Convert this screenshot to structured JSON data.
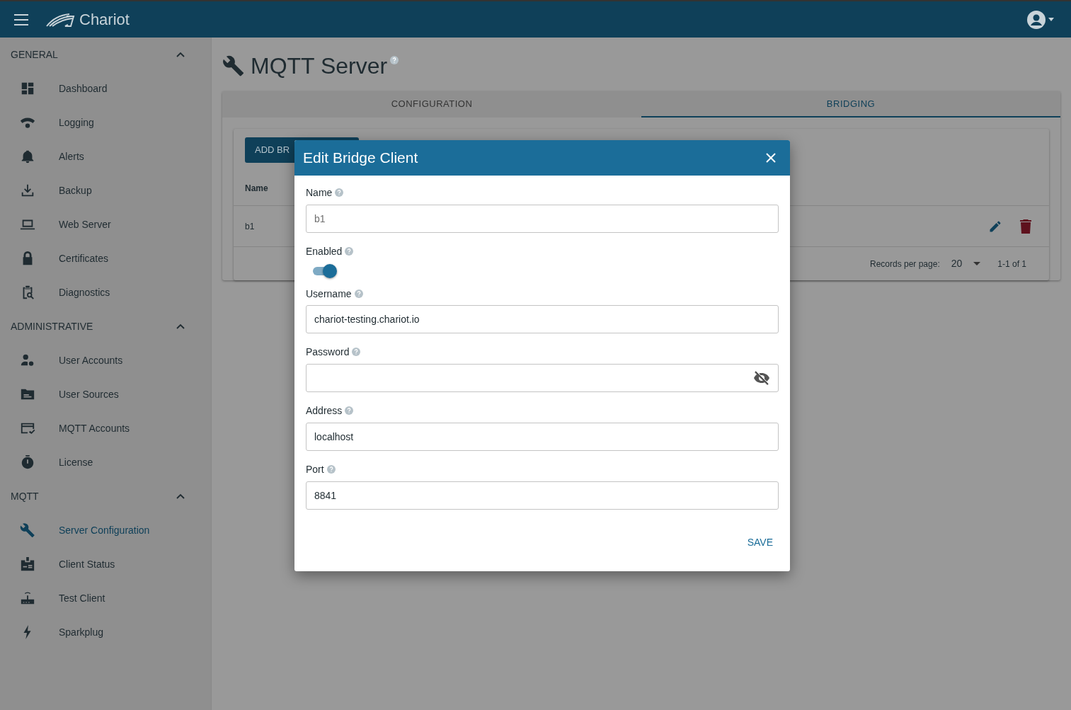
{
  "topbar": {
    "brand": "Chariot"
  },
  "sidebar": {
    "sections": [
      {
        "title": "GENERAL",
        "expanded": true,
        "items": [
          {
            "label": "Dashboard",
            "selected": false
          },
          {
            "label": "Logging",
            "selected": false
          },
          {
            "label": "Alerts",
            "selected": false
          },
          {
            "label": "Backup",
            "selected": false
          },
          {
            "label": "Web Server",
            "selected": false
          },
          {
            "label": "Certificates",
            "selected": false
          },
          {
            "label": "Diagnostics",
            "selected": false
          }
        ]
      },
      {
        "title": "ADMINISTRATIVE",
        "expanded": true,
        "items": [
          {
            "label": "User Accounts",
            "selected": false
          },
          {
            "label": "User Sources",
            "selected": false
          },
          {
            "label": "MQTT Accounts",
            "selected": false
          },
          {
            "label": "License",
            "selected": false
          }
        ]
      },
      {
        "title": "MQTT",
        "expanded": true,
        "items": [
          {
            "label": "Server Configuration",
            "selected": true
          },
          {
            "label": "Client Status",
            "selected": false
          },
          {
            "label": "Test Client",
            "selected": false
          },
          {
            "label": "Sparkplug",
            "selected": false
          }
        ]
      }
    ]
  },
  "page": {
    "title": "MQTT Server",
    "tabs": [
      {
        "label": "CONFIGURATION",
        "selected": false
      },
      {
        "label": "BRIDGING",
        "selected": true
      }
    ],
    "add_button": "ADD BR",
    "table": {
      "columns": [
        "Name"
      ],
      "rows": [
        {
          "name": "b1"
        }
      ]
    },
    "pagination": {
      "records_label": "Records per page:",
      "per_page": "20",
      "range": "1-1 of 1"
    }
  },
  "dialog": {
    "title": "Edit Bridge Client",
    "fields": [
      {
        "kind": "text",
        "label": "Name",
        "value": "b1",
        "disabled": true
      },
      {
        "kind": "switch",
        "label": "Enabled",
        "on": true
      },
      {
        "kind": "text",
        "label": "Username",
        "value": "chariot-testing.chariot.io",
        "disabled": false
      },
      {
        "kind": "password",
        "label": "Password"
      },
      {
        "kind": "text",
        "label": "Address",
        "value": "localhost",
        "disabled": false
      },
      {
        "kind": "text",
        "label": "Port",
        "value": "8841",
        "disabled": false
      }
    ],
    "save": "SAVE"
  }
}
